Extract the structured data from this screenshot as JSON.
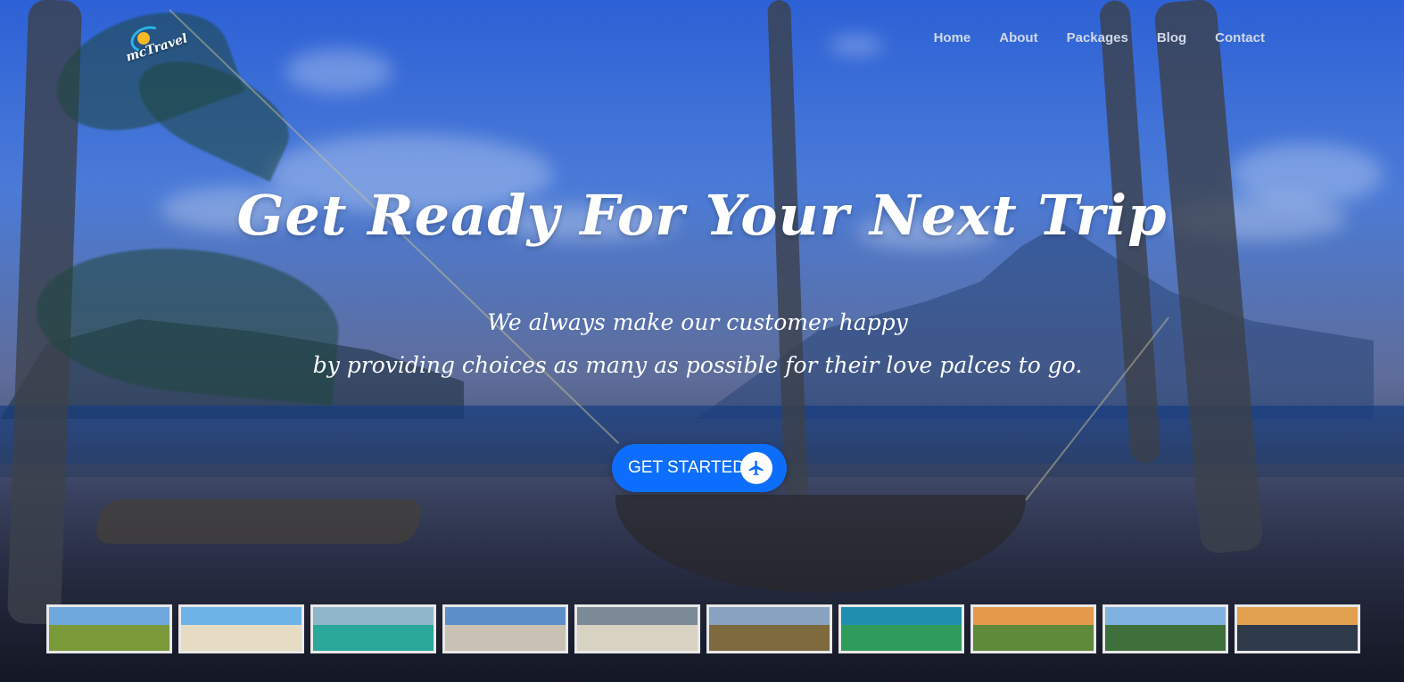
{
  "brand": {
    "logo_text": "mcTravel"
  },
  "nav": {
    "items": [
      {
        "label": "Home"
      },
      {
        "label": "About"
      },
      {
        "label": "Packages"
      },
      {
        "label": "Blog"
      },
      {
        "label": "Contact"
      }
    ]
  },
  "hero": {
    "title": "Get Ready For Your Next Trip",
    "subtitle_line1": "We always make our customer happy",
    "subtitle_line2": "by providing choices as many as possible for their love palces to go.",
    "cta_label": "GET STARTED",
    "cta_icon": "airplane-icon"
  },
  "colors": {
    "accent": "#0d6efd",
    "nav_text": "#cfd8e8",
    "hero_overlay": "#1a55cc"
  },
  "thumbnails": [
    {
      "name": "rice-terraces",
      "sky": "#6fa8dc",
      "land": "#7a9a3a"
    },
    {
      "name": "beach-palms",
      "sky": "#6db3e8",
      "land": "#e6dcc4"
    },
    {
      "name": "lagoon-cliffs",
      "sky": "#8fb7c9",
      "land": "#2aa89a"
    },
    {
      "name": "lighthouse",
      "sky": "#5c8fc7",
      "land": "#c9c2b4"
    },
    {
      "name": "cove-boat",
      "sky": "#7b8a96",
      "land": "#d8d2c2"
    },
    {
      "name": "chocolate-hills",
      "sky": "#88a2bf",
      "land": "#7d6a3e"
    },
    {
      "name": "reef-aerial",
      "sky": "#1f8fb0",
      "land": "#2f9c5c"
    },
    {
      "name": "volcano-sunset",
      "sky": "#e39a4a",
      "land": "#5e8a3a"
    },
    {
      "name": "green-hills",
      "sky": "#7fb2e0",
      "land": "#3f6f3a"
    },
    {
      "name": "sunset-shore",
      "sky": "#e0a050",
      "land": "#2e3a4a"
    }
  ]
}
